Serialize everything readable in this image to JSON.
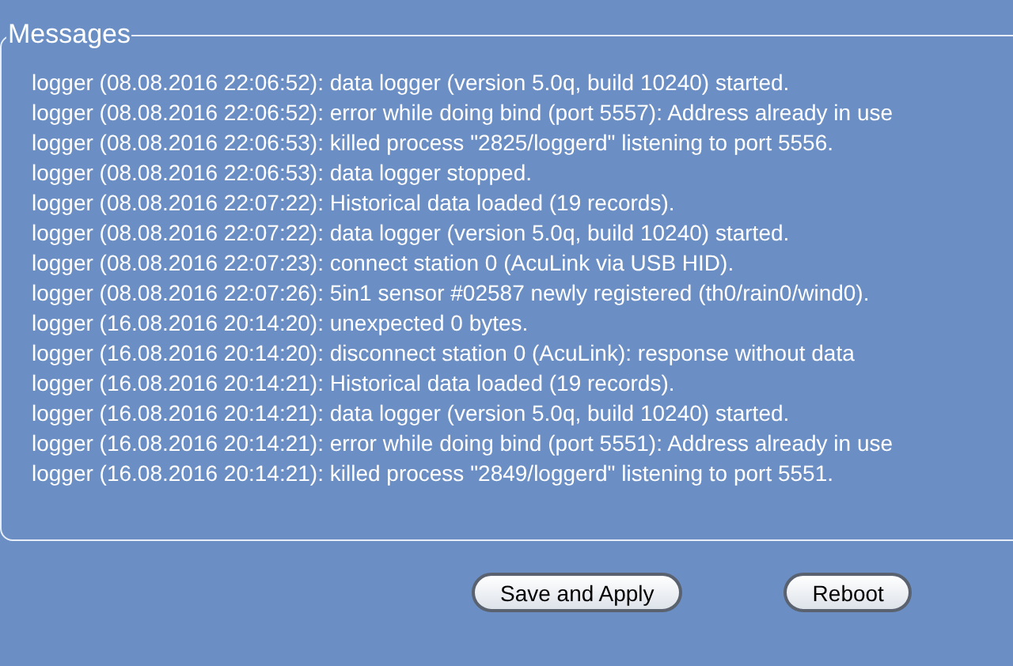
{
  "messages_panel": {
    "legend": "Messages",
    "lines": [
      "logger (08.08.2016 22:06:52): data logger (version 5.0q, build 10240) started.",
      "logger (08.08.2016 22:06:52): error while doing bind (port 5557): Address already in use",
      "logger (08.08.2016 22:06:53): killed process \"2825/loggerd\" listening to port 5556.",
      "logger (08.08.2016 22:06:53): data logger stopped.",
      "logger (08.08.2016 22:07:22): Historical data loaded (19 records).",
      "logger (08.08.2016 22:07:22): data logger (version 5.0q, build 10240) started.",
      "logger (08.08.2016 22:07:23): connect station 0 (AcuLink via USB HID).",
      "logger (08.08.2016 22:07:26): 5in1 sensor #02587 newly registered (th0/rain0/wind0).",
      "logger (16.08.2016 20:14:20): unexpected 0 bytes.",
      "logger (16.08.2016 20:14:20): disconnect station 0 (AcuLink): response without data",
      "logger (16.08.2016 20:14:21): Historical data loaded (19 records).",
      "logger (16.08.2016 20:14:21): data logger (version 5.0q, build 10240) started.",
      "logger (16.08.2016 20:14:21): error while doing bind (port 5551): Address already in use",
      "logger (16.08.2016 20:14:21): killed process \"2849/loggerd\" listening to port 5551."
    ]
  },
  "buttons": [
    {
      "label": "Save and Apply"
    },
    {
      "label": "Reboot"
    }
  ]
}
